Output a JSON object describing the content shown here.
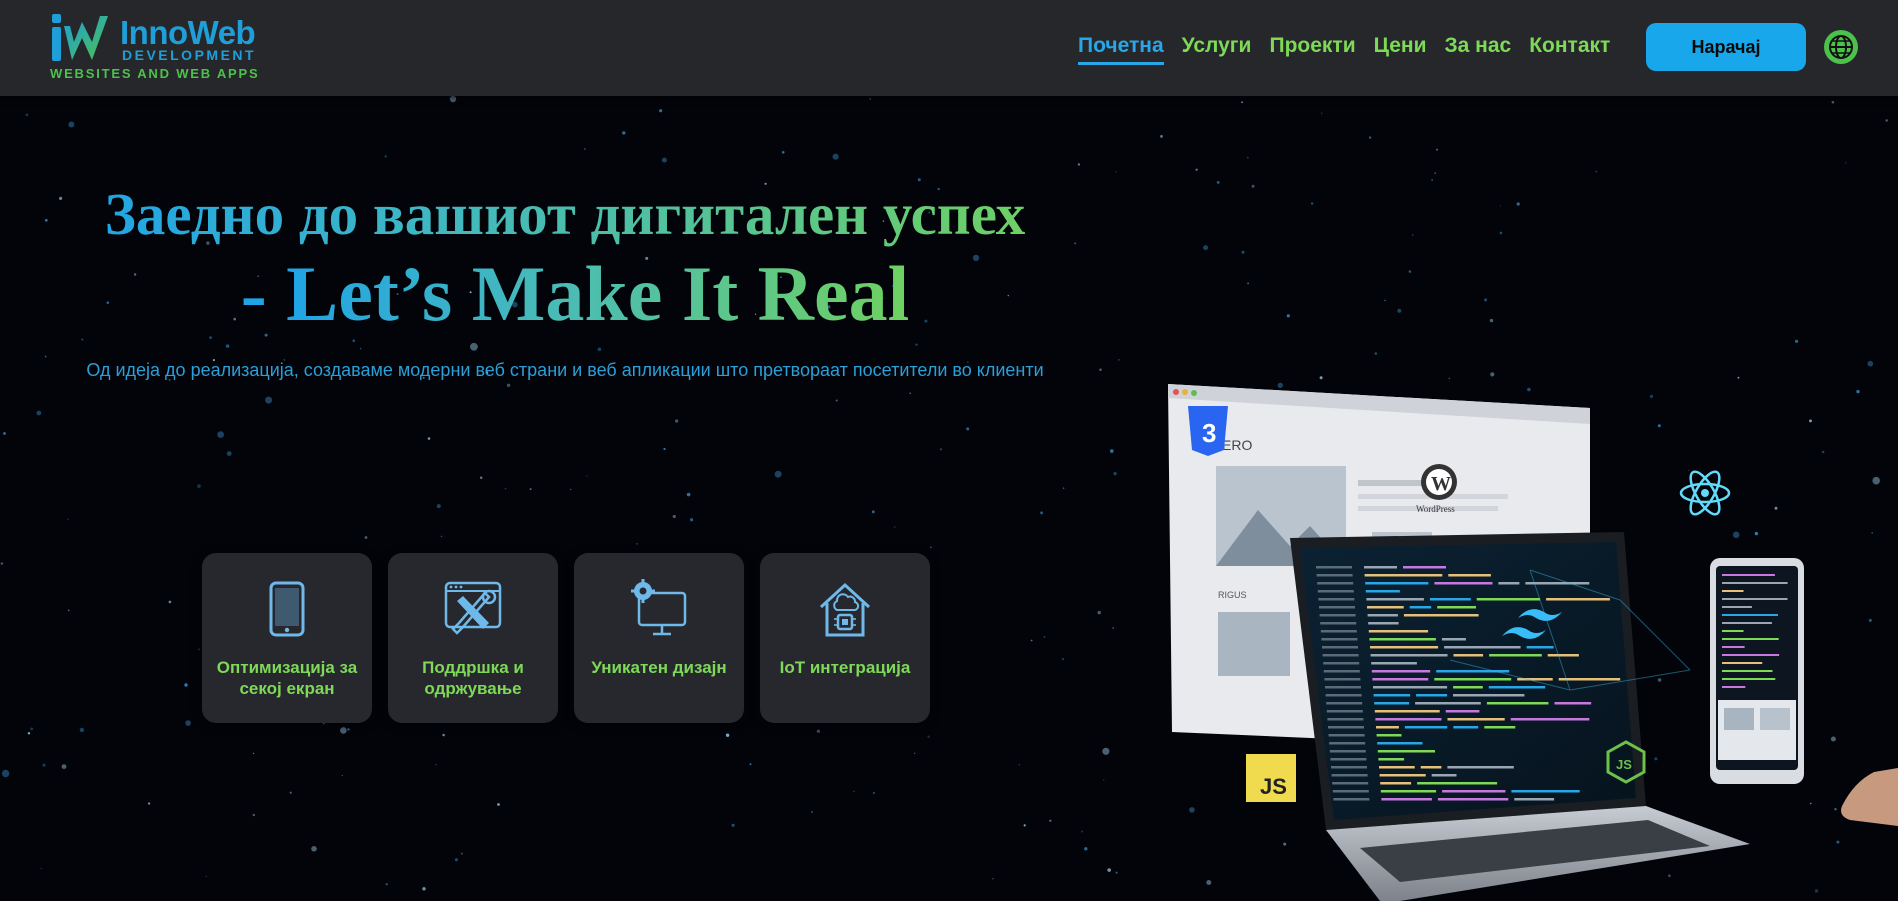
{
  "brand": {
    "name": "InnoWeb",
    "sub": "DEVELOPMENT",
    "tagline": "WEBSITES AND WEB APPS"
  },
  "nav": {
    "items": [
      {
        "label": "Почетна",
        "active": true
      },
      {
        "label": "Услуги"
      },
      {
        "label": "Проекти"
      },
      {
        "label": "Цени"
      },
      {
        "label": "За нас"
      },
      {
        "label": "Контакт"
      }
    ],
    "order_label": "Нарачај"
  },
  "hero": {
    "title": "Заедно до вашиот дигитален успех",
    "subtitle_dash": "- ",
    "subtitle": "Let’s Make It Real",
    "description": "Од идеја до реализација, создаваме модерни веб страни и веб апликации што претвораат посетители во клиенти"
  },
  "features": [
    {
      "icon": "tablet-icon",
      "label": "Оптимизација за секој екран"
    },
    {
      "icon": "tools-icon",
      "label": "Поддршка и одржување"
    },
    {
      "icon": "monitor-gear-icon",
      "label": "Уникатен дизајн"
    },
    {
      "icon": "smart-home-icon",
      "label": "IoT интеграција"
    }
  ],
  "illustration": {
    "website_heading": "ERO",
    "website_section": "RIGUS",
    "wordpress_label": "WordPress",
    "js_label": "JS",
    "css_label": "3"
  },
  "colors": {
    "header_bg": "#25272b",
    "accent_blue": "#29a6e6",
    "accent_green": "#7ed957",
    "button_bg": "#17a7ea",
    "card_bg": "#26282d",
    "page_bg": "#02040a"
  }
}
